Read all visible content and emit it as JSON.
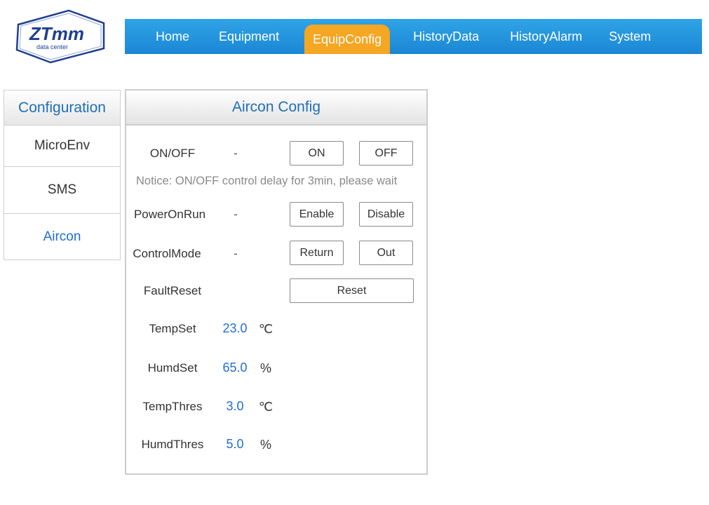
{
  "logo": {
    "brand": "ZTmm",
    "subtitle": "data center",
    "colors": {
      "navy": "#1f3f8f"
    }
  },
  "nav": {
    "items": [
      {
        "label": "Home"
      },
      {
        "label": "Equipment"
      },
      {
        "label": "EquipConfig",
        "active": true
      },
      {
        "label": "HistoryData"
      },
      {
        "label": "HistoryAlarm"
      },
      {
        "label": "System"
      }
    ],
    "colors": {
      "bar": "#1b86d4",
      "active": "#f5a623"
    }
  },
  "sidebar": {
    "title": "Configuration",
    "items": [
      {
        "label": "MicroEnv"
      },
      {
        "label": "SMS"
      },
      {
        "label": "Aircon",
        "active": true
      }
    ]
  },
  "panel": {
    "title": "Aircon Config",
    "onoff": {
      "label": "ON/OFF",
      "value": "-",
      "on_label": "ON",
      "off_label": "OFF"
    },
    "notice": "Notice: ON/OFF control delay for 3min, please wait",
    "poweronrun": {
      "label": "PowerOnRun",
      "value": "-",
      "enable_label": "Enable",
      "disable_label": "Disable"
    },
    "controlmode": {
      "label": "ControlMode",
      "value": "-",
      "return_label": "Return",
      "out_label": "Out"
    },
    "faultreset": {
      "label": "FaultReset",
      "reset_label": "Reset"
    },
    "tempset": {
      "label": "TempSet",
      "value": "23.0",
      "unit": "℃"
    },
    "humdset": {
      "label": "HumdSet",
      "value": "65.0",
      "unit": "%"
    },
    "tempthres": {
      "label": "TempThres",
      "value": "3.0",
      "unit": "℃"
    },
    "humdthres": {
      "label": "HumdThres",
      "value": "5.0",
      "unit": "%"
    },
    "colors": {
      "value": "#1f6fd0",
      "title": "#1f6fb5"
    }
  }
}
